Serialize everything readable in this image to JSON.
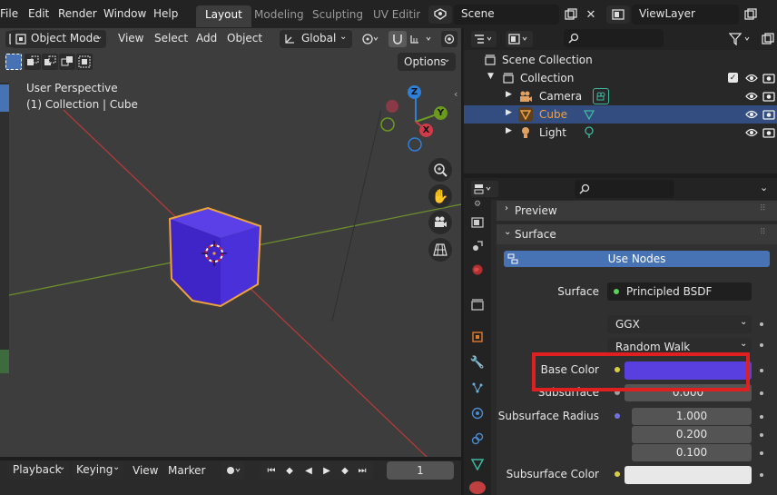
{
  "menu": [
    "File",
    "Edit",
    "Render",
    "Window",
    "Help"
  ],
  "workspaces": [
    {
      "label": "Layout",
      "active": true
    },
    {
      "label": "Modeling",
      "active": false
    },
    {
      "label": "Sculpting",
      "active": false
    },
    {
      "label": "UV Editing",
      "active": false
    }
  ],
  "scene": {
    "name": "Scene"
  },
  "view_layer": {
    "name": "ViewLayer"
  },
  "viewport": {
    "mode": "Object Mode",
    "header_menu": [
      "View",
      "Select",
      "Add",
      "Object"
    ],
    "transform_orientation": "Global",
    "options_label": "Options",
    "info_line1": "User Perspective",
    "info_line2": "(1) Collection | Cube",
    "gizmo_axes": {
      "x": "X",
      "y": "Y",
      "z": "Z"
    },
    "colors": {
      "bg": "#3d3d3d",
      "cube": "#4a2fd0",
      "selection": "#f0a23a",
      "x_axis": "#b23a3a",
      "y_axis": "#6c8f2b"
    }
  },
  "outliner": {
    "rows": [
      {
        "label": "Scene Collection",
        "selected": false
      },
      {
        "label": "Collection",
        "selected": false
      },
      {
        "label": "Camera",
        "selected": false
      },
      {
        "label": "Cube",
        "selected": true
      },
      {
        "label": "Light",
        "selected": false
      }
    ]
  },
  "properties": {
    "panels": {
      "preview": "Preview",
      "surface": "Surface"
    },
    "use_nodes": "Use Nodes",
    "surface_label": "Surface",
    "surface_shader": "Principled BSDF",
    "distribution": "GGX",
    "subsurface_method": "Random Walk",
    "base_color_label": "Base Color",
    "base_color_value": "#5a3fe0",
    "subsurface_label": "Subsurface",
    "subsurface_value": "0.000",
    "subsurface_radius_label": "Subsurface Radius",
    "subsurface_radius": [
      "1.000",
      "0.200",
      "0.100"
    ],
    "subsurface_color_label": "Subsurface Color",
    "subsurface_color_value": "#e8e8e8",
    "highlight_color": "#e02020"
  },
  "timeline": {
    "menu": [
      "Playback",
      "Keying",
      "View",
      "Marker"
    ],
    "current_frame": "1"
  }
}
